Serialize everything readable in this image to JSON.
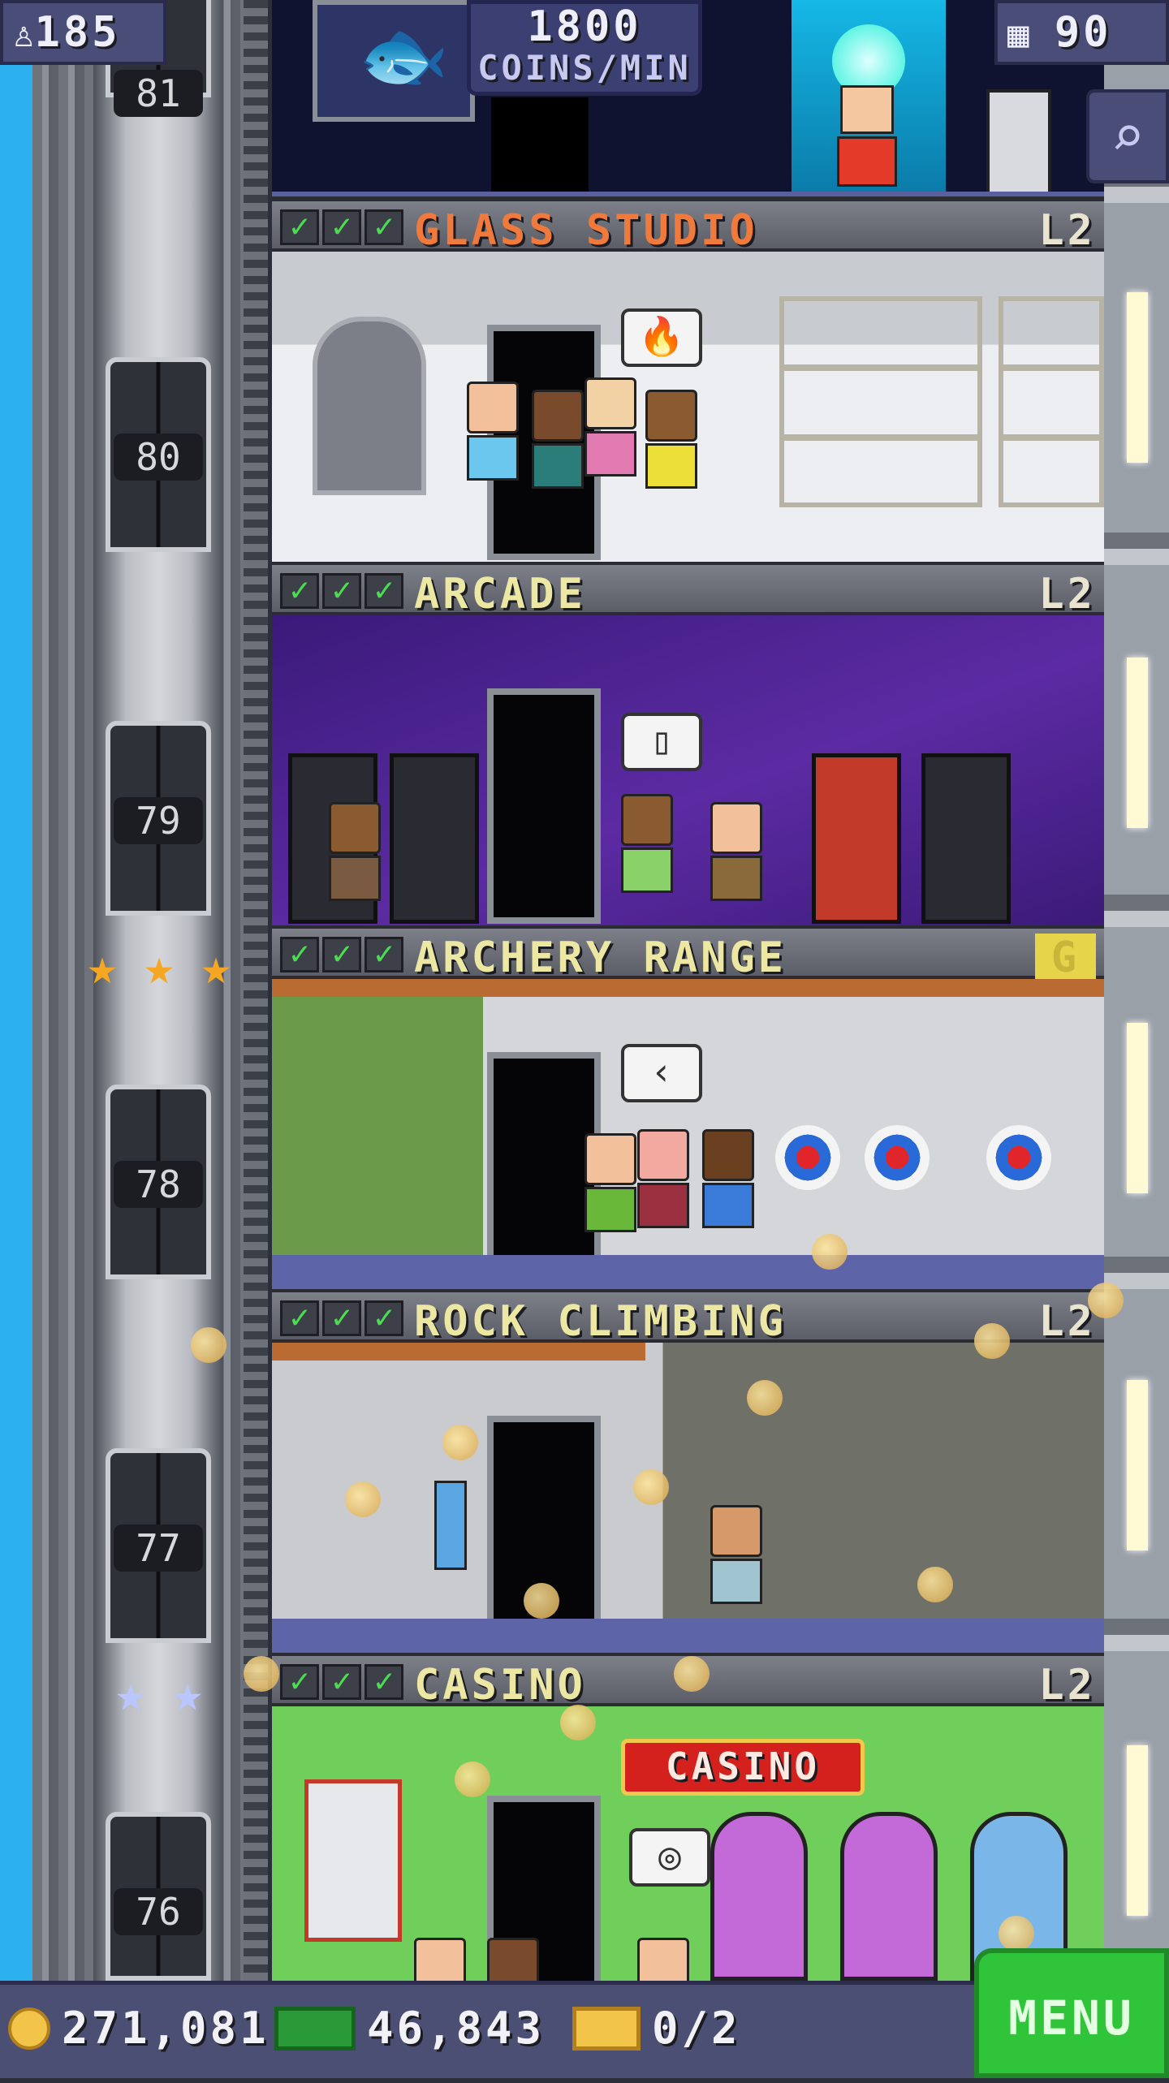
{
  "hud": {
    "population": "185",
    "floors": "90",
    "coins_per_min_value": "1800",
    "coins_per_min_label": "COINS/MIN"
  },
  "elevator": {
    "floor_numbers": [
      "81",
      "80",
      "79",
      "78",
      "77",
      "76"
    ]
  },
  "floors": [
    {
      "name": "GLASS STUDIO",
      "level": "L2",
      "checks": 3,
      "bubble": "🔥"
    },
    {
      "name": "ARCADE",
      "level": "L2",
      "checks": 3,
      "bubble": "▯"
    },
    {
      "name": "ARCHERY RANGE",
      "level": "G",
      "checks": 3,
      "bubble": "‹"
    },
    {
      "name": "ROCK CLIMBING",
      "level": "L2",
      "checks": 3,
      "bubble": ""
    },
    {
      "name": "CASINO",
      "level": "L2",
      "checks": 3,
      "bubble": "◎",
      "sign": "CASINO"
    }
  ],
  "bottom_bar": {
    "coins": "271,081",
    "bux": "46,843",
    "tickets": "0/2",
    "menu_label": "MENU"
  },
  "colors": {
    "sky": "#2cb0ef",
    "hud": "#4a4d78",
    "menu": "#2fc43a",
    "floor_name_glass": "#f07a3c",
    "floor_name": "#ece7a2"
  },
  "icons": [
    "population-icon",
    "building-icon",
    "magnify-icon",
    "coin-icon",
    "bux-icon",
    "ticket-icon",
    "star-icon"
  ]
}
